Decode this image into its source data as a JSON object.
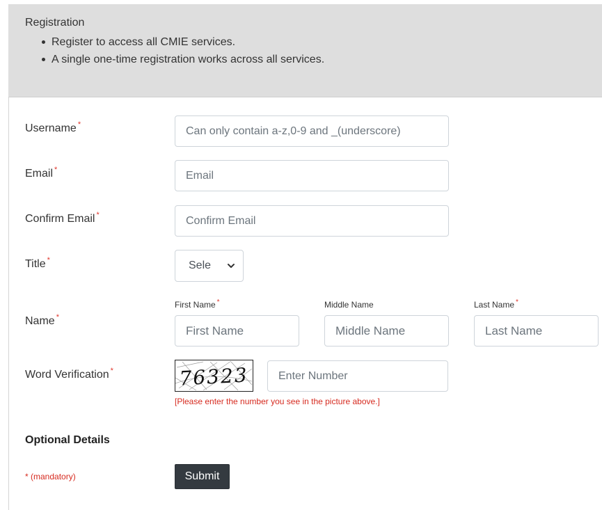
{
  "header": {
    "title": "Registration",
    "bullets": [
      "Register to access all CMIE services.",
      "A single one-time registration works across all services."
    ]
  },
  "fields": {
    "username": {
      "label": "Username",
      "placeholder": "Can only contain a-z,0-9 and _(underscore)"
    },
    "email": {
      "label": "Email",
      "placeholder": "Email"
    },
    "confirm_email": {
      "label": "Confirm Email",
      "placeholder": "Confirm Email"
    },
    "title": {
      "label": "Title",
      "selected": "Sele"
    },
    "name": {
      "label": "Name",
      "first": {
        "label": "First Name",
        "placeholder": "First Name"
      },
      "middle": {
        "label": "Middle Name",
        "placeholder": "Middle Name"
      },
      "last": {
        "label": "Last Name",
        "placeholder": "Last Name"
      }
    },
    "verification": {
      "label": "Word Verification",
      "captcha_text": "76323",
      "placeholder": "Enter Number",
      "hint": "[Please enter the number you see in the picture above.]"
    }
  },
  "required_marker": "*",
  "optional_section": "Optional Details",
  "mandatory_note": "* (mandatory)",
  "submit_label": "Submit",
  "colors": {
    "header_bg": "#dedede",
    "required": "#e0352b",
    "button_bg": "#343a40"
  }
}
